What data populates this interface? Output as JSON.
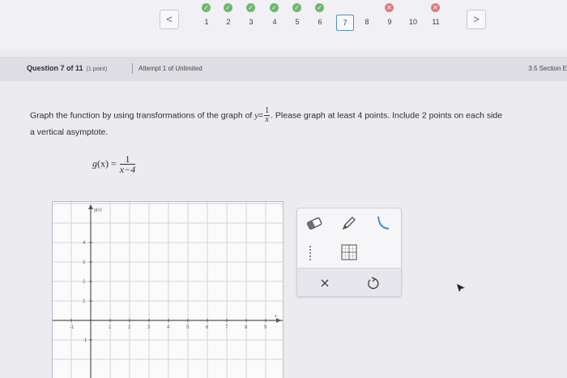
{
  "nav": {
    "prev_symbol": "<",
    "next_symbol": ">",
    "questions": [
      {
        "label": "1",
        "status": "correct"
      },
      {
        "label": "2",
        "status": "correct"
      },
      {
        "label": "3",
        "status": "correct"
      },
      {
        "label": "4",
        "status": "correct"
      },
      {
        "label": "5",
        "status": "correct"
      },
      {
        "label": "6",
        "status": "correct"
      },
      {
        "label": "7",
        "status": "current"
      },
      {
        "label": "8",
        "status": "none"
      },
      {
        "label": "9",
        "status": "incorrect"
      },
      {
        "label": "10",
        "status": "none"
      },
      {
        "label": "11",
        "status": "incorrect"
      }
    ],
    "correct_mark": "✓",
    "incorrect_mark": "✕",
    "colors": {
      "correct": "#6ab96d",
      "incorrect": "#de7b7b",
      "current_border": "#5d8fb9"
    }
  },
  "header": {
    "title": "Question 7 of 11",
    "points": "(1 point)",
    "attempt": "Attempt 1 of Unlimited",
    "section": "3.5 Section E"
  },
  "question": {
    "text_before": "Graph the function by using transformations of the graph of ",
    "y_var": "y",
    "equals": "=",
    "base_num": "1",
    "base_den": "x",
    "text_after": ". Please graph at least 4 points. Include 2 points on each side",
    "text_line2": "a vertical asymptote.",
    "func_name": "g",
    "func_arg": "(x)",
    "func_equals": " = ",
    "func_num": "1",
    "func_den": "x−4"
  },
  "graph": {
    "y_axis_label": "g(x)",
    "x_axis_label": "x",
    "x_ticks": [
      "-1",
      "1",
      "2",
      "3",
      "4",
      "5",
      "6",
      "7",
      "8",
      "9"
    ],
    "y_ticks": [
      "4",
      "3",
      "2",
      "1",
      "-1"
    ]
  },
  "tools": {
    "items": [
      "eraser-icon",
      "pencil-icon",
      "curve-icon",
      "asymptote-line-icon",
      "grid-icon",
      "clear-icon",
      "undo-icon"
    ]
  }
}
